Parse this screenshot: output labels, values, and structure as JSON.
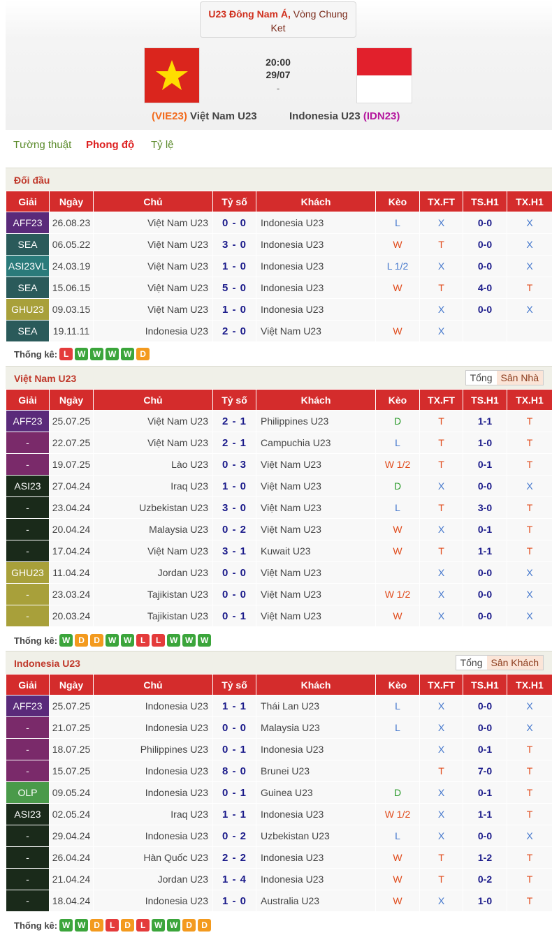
{
  "match": {
    "competition_bold": "U23 Đông Nam Á,",
    "competition_rest_line1": " Vòng Chung",
    "competition_rest_line2": "Ket",
    "time": "20:00",
    "date": "29/07",
    "dash": "-",
    "home_code": "(VIE23)",
    "home_name": "Việt Nam U23",
    "away_name": "Indonesia U23",
    "away_code": "(IDN23)"
  },
  "tabs": [
    "Tường thuật",
    "Phong độ",
    "Tỷ lệ"
  ],
  "columns": [
    "Giải",
    "Ngày",
    "Chủ",
    "Tỷ số",
    "Khách",
    "Kèo",
    "TX.FT",
    "TS.H1",
    "TX.H1"
  ],
  "stat_label": "Thống kê:",
  "league_colors": {
    "AFF23": "#5a2a7a",
    "SEA": "#2a5a5a",
    "ASI23VL": "#2a7a7a",
    "GHU23": "#a8a03a",
    "-": "#7a2a6a",
    "ASI23": "#1a2a1a",
    "OLP": "#4a9a4a"
  },
  "h2h": {
    "title": "Đối đầu",
    "rows": [
      [
        "AFF23",
        "26.08.23",
        "Việt Nam U23",
        "0 - 0",
        "Indonesia U23",
        "L",
        "X",
        "0-0",
        "X"
      ],
      [
        "SEA",
        "06.05.22",
        "Việt Nam U23",
        "3 - 0",
        "Indonesia U23",
        "W",
        "T",
        "0-0",
        "X"
      ],
      [
        "ASI23VL",
        "24.03.19",
        "Việt Nam U23",
        "1 - 0",
        "Indonesia U23",
        "L 1/2",
        "X",
        "0-0",
        "X"
      ],
      [
        "SEA",
        "15.06.15",
        "Việt Nam U23",
        "5 - 0",
        "Indonesia U23",
        "W",
        "T",
        "4-0",
        "T"
      ],
      [
        "GHU23",
        "09.03.15",
        "Việt Nam U23",
        "1 - 0",
        "Indonesia U23",
        "",
        "X",
        "0-0",
        "X"
      ],
      [
        "SEA",
        "19.11.11",
        "Indonesia U23",
        "2 - 0",
        "Việt Nam U23",
        "W",
        "X",
        "",
        ""
      ]
    ],
    "form": [
      "L",
      "W",
      "W",
      "W",
      "W",
      "D"
    ]
  },
  "home": {
    "title": "Việt Nam U23",
    "toggle": [
      "Tổng",
      "Sân Nhà"
    ],
    "row_colors": [
      "#5a2a7a",
      "#7a2a6a",
      "#7a2a6a",
      "#1a2a1a",
      "#1a2a1a",
      "#1a2a1a",
      "#1a2a1a",
      "#a8a03a",
      "#a8a03a",
      "#a8a03a"
    ],
    "rows": [
      [
        "AFF23",
        "25.07.25",
        "Việt Nam U23",
        "2 - 1",
        "Philippines U23",
        "D",
        "T",
        "1-1",
        "T"
      ],
      [
        "-",
        "22.07.25",
        "Việt Nam U23",
        "2 - 1",
        "Campuchia U23",
        "L",
        "T",
        "1-0",
        "T"
      ],
      [
        "-",
        "19.07.25",
        "Lào U23",
        "0 - 3",
        "Việt Nam U23",
        "W 1/2",
        "T",
        "0-1",
        "T"
      ],
      [
        "ASI23",
        "27.04.24",
        "Iraq U23",
        "1 - 0",
        "Việt Nam U23",
        "D",
        "X",
        "0-0",
        "X"
      ],
      [
        "-",
        "23.04.24",
        "Uzbekistan U23",
        "3 - 0",
        "Việt Nam U23",
        "L",
        "T",
        "3-0",
        "T"
      ],
      [
        "-",
        "20.04.24",
        "Malaysia U23",
        "0 - 2",
        "Việt Nam U23",
        "W",
        "X",
        "0-1",
        "T"
      ],
      [
        "-",
        "17.04.24",
        "Việt Nam U23",
        "3 - 1",
        "Kuwait U23",
        "W",
        "T",
        "1-1",
        "T"
      ],
      [
        "GHU23",
        "11.04.24",
        "Jordan U23",
        "0 - 0",
        "Việt Nam U23",
        "",
        "X",
        "0-0",
        "X"
      ],
      [
        "-",
        "23.03.24",
        "Tajikistan U23",
        "0 - 0",
        "Việt Nam U23",
        "W 1/2",
        "X",
        "0-0",
        "X"
      ],
      [
        "-",
        "20.03.24",
        "Tajikistan U23",
        "0 - 1",
        "Việt Nam U23",
        "W",
        "X",
        "0-0",
        "X"
      ]
    ],
    "form": [
      "W",
      "D",
      "D",
      "W",
      "W",
      "L",
      "L",
      "W",
      "W",
      "W"
    ]
  },
  "away": {
    "title": "Indonesia U23",
    "toggle": [
      "Tổng",
      "Sân Khách"
    ],
    "row_colors": [
      "#5a2a7a",
      "#7a2a6a",
      "#7a2a6a",
      "#7a2a6a",
      "#4a9a4a",
      "#1a2a1a",
      "#1a2a1a",
      "#1a2a1a",
      "#1a2a1a",
      "#1a2a1a"
    ],
    "rows": [
      [
        "AFF23",
        "25.07.25",
        "Indonesia U23",
        "1 - 1",
        "Thái Lan U23",
        "L",
        "X",
        "0-0",
        "X"
      ],
      [
        "-",
        "21.07.25",
        "Indonesia U23",
        "0 - 0",
        "Malaysia U23",
        "L",
        "X",
        "0-0",
        "X"
      ],
      [
        "-",
        "18.07.25",
        "Philippines U23",
        "0 - 1",
        "Indonesia U23",
        "",
        "X",
        "0-1",
        "T"
      ],
      [
        "-",
        "15.07.25",
        "Indonesia U23",
        "8 - 0",
        "Brunei U23",
        "",
        "T",
        "7-0",
        "T"
      ],
      [
        "OLP",
        "09.05.24",
        "Indonesia U23",
        "0 - 1",
        "Guinea U23",
        "D",
        "X",
        "0-1",
        "T"
      ],
      [
        "ASI23",
        "02.05.24",
        "Iraq U23",
        "1 - 1",
        "Indonesia U23",
        "W 1/2",
        "X",
        "1-1",
        "T"
      ],
      [
        "-",
        "29.04.24",
        "Indonesia U23",
        "0 - 2",
        "Uzbekistan U23",
        "L",
        "X",
        "0-0",
        "X"
      ],
      [
        "-",
        "26.04.24",
        "Hàn Quốc U23",
        "2 - 2",
        "Indonesia U23",
        "W",
        "T",
        "1-2",
        "T"
      ],
      [
        "-",
        "21.04.24",
        "Jordan U23",
        "1 - 4",
        "Indonesia U23",
        "W",
        "T",
        "0-2",
        "T"
      ],
      [
        "-",
        "18.04.24",
        "Indonesia U23",
        "1 - 0",
        "Australia U23",
        "W",
        "X",
        "1-0",
        "T"
      ]
    ],
    "form": [
      "W",
      "W",
      "D",
      "L",
      "D",
      "L",
      "W",
      "W",
      "D",
      "D"
    ]
  }
}
